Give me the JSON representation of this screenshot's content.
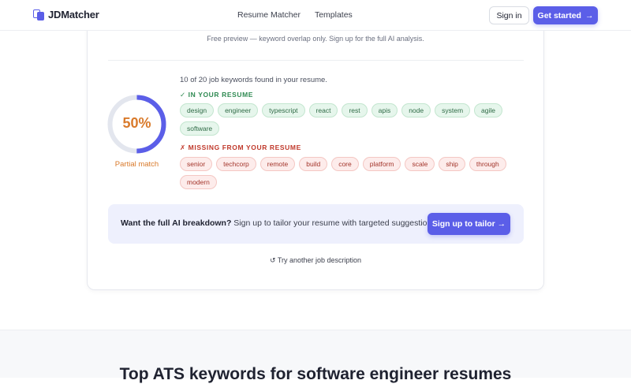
{
  "header": {
    "logo_text": "JDMatcher",
    "nav": [
      "Resume Matcher",
      "Templates"
    ],
    "signin_label": "Sign in",
    "get_started_label": "Get started",
    "get_started_arrow": "→"
  },
  "card": {
    "preview_note": "Free preview — keyword overlap only. Sign up for the full AI analysis.",
    "match": {
      "percent_label": "50%",
      "percent_value": 50,
      "status_label": "Partial match",
      "accent_color": "#5b5ee8",
      "status_color": "#d97a2b"
    },
    "summary": "10 of 20 job keywords found in your resume.",
    "in_resume": {
      "title": "✓ IN YOUR RESUME",
      "keywords": [
        "design",
        "engineer",
        "typescript",
        "react",
        "rest",
        "apis",
        "node",
        "system",
        "agile",
        "software"
      ]
    },
    "missing": {
      "title": "✗ MISSING FROM YOUR RESUME",
      "keywords": [
        "senior",
        "techcorp",
        "remote",
        "build",
        "core",
        "platform",
        "scale",
        "ship",
        "through",
        "modern"
      ]
    },
    "cta": {
      "bold": "Want the full AI breakdown?",
      "text": " Sign up to tailor your resume with targeted suggestions.",
      "button_label": "Sign up to tailor →"
    },
    "retry_label": "↺ Try another job description"
  },
  "lower": {
    "title": "Top ATS keywords for software engineer resumes"
  }
}
